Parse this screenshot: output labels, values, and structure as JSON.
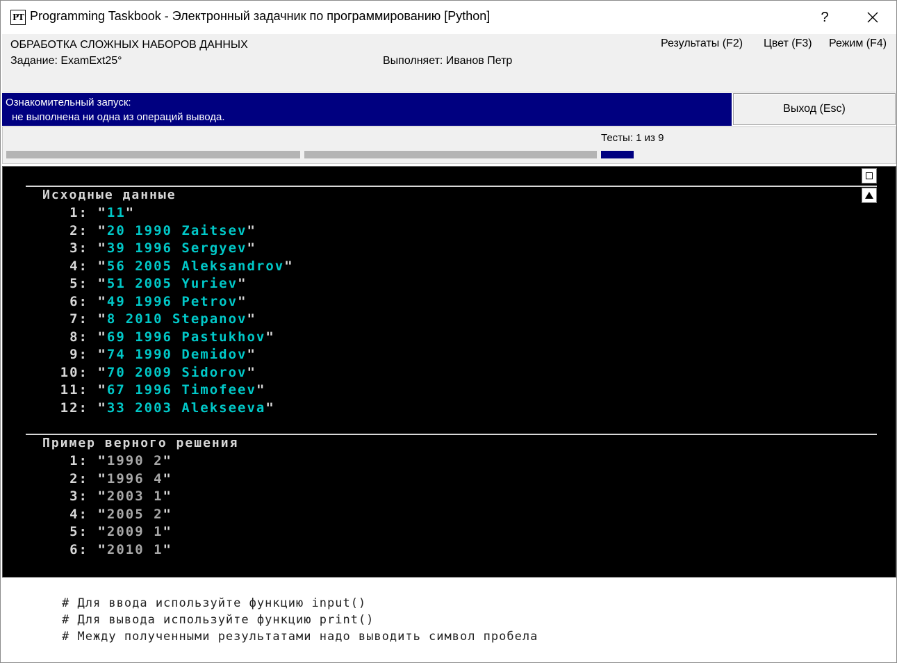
{
  "window": {
    "app_icon_text": "PT",
    "title": "Programming Taskbook - Электронный задачник по программированию [Python]",
    "help_label": "?",
    "close_icon": "close-icon"
  },
  "header": {
    "group": "ОБРАБОТКА СЛОЖНЫХ НАБОРОВ ДАННЫХ",
    "task": "Задание: ExamExt25°",
    "performer": "Выполняет: Иванов Петр",
    "menu": {
      "results": "Результаты (F2)",
      "color": "Цвет (F3)",
      "mode": "Режим (F4)"
    }
  },
  "status": {
    "line1": "Ознакомительный запуск:",
    "line2": "не выполнена ни одна из операций вывода.",
    "color": "#000080"
  },
  "exit_button": "Выход (Esc)",
  "tests": {
    "label": "Тесты:  1 из 9",
    "current": 1,
    "total": 9
  },
  "console": {
    "input_title": "Исходные данные",
    "input_rows": [
      {
        "num": "1:",
        "value": "11"
      },
      {
        "num": "2:",
        "value": "20 1990 Zaitsev"
      },
      {
        "num": "3:",
        "value": "39 1996 Sergyev"
      },
      {
        "num": "4:",
        "value": "56 2005 Aleksandrov"
      },
      {
        "num": "5:",
        "value": "51 2005 Yuriev"
      },
      {
        "num": "6:",
        "value": "49 1996 Petrov"
      },
      {
        "num": "7:",
        "value": "8 2010 Stepanov"
      },
      {
        "num": "8:",
        "value": "69 1996 Pastukhov"
      },
      {
        "num": "9:",
        "value": "74 1990 Demidov"
      },
      {
        "num": "10:",
        "value": "70 2009 Sidorov"
      },
      {
        "num": "11:",
        "value": "67 1996 Timofeev"
      },
      {
        "num": "12:",
        "value": "33 2003 Alekseeva"
      }
    ],
    "example_title": "Пример верного решения",
    "example_rows": [
      {
        "num": "1:",
        "value": "1990 2"
      },
      {
        "num": "2:",
        "value": "1996 4"
      },
      {
        "num": "3:",
        "value": "2003 1"
      },
      {
        "num": "4:",
        "value": "2005 2"
      },
      {
        "num": "5:",
        "value": "2009 1"
      },
      {
        "num": "6:",
        "value": "2010 1"
      }
    ],
    "input_color": "#00c8c8",
    "example_color": "#a8a8a8"
  },
  "comments": {
    "line1": "# Для ввода используйте функцию input()",
    "line2": "# Для вывода используйте функцию print()",
    "line3": "# Между полученными результатами надо выводить символ пробела"
  }
}
